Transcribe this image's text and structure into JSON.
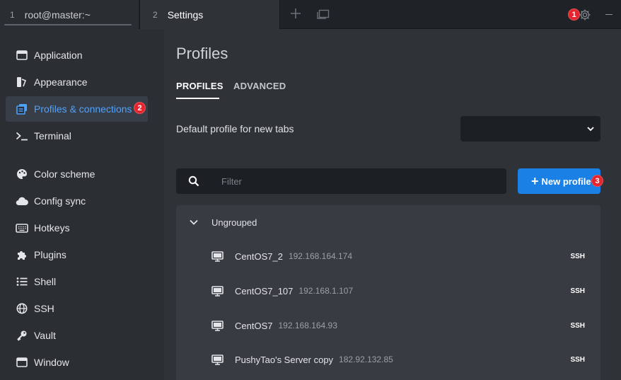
{
  "tabs": [
    {
      "num": "1",
      "title": "root@master:~"
    },
    {
      "num": "2",
      "title": "Settings"
    }
  ],
  "badges": {
    "gear": "1",
    "sidebar": "2",
    "new_profile": "3"
  },
  "sidebar": {
    "items": [
      {
        "label": "Application",
        "icon": "window-icon"
      },
      {
        "label": "Appearance",
        "icon": "palette-icon"
      },
      {
        "label": "Profiles & connections",
        "icon": "profiles-icon",
        "active": true
      },
      {
        "label": "Terminal",
        "icon": "terminal-icon"
      },
      {
        "label": "Color scheme",
        "icon": "palette-icon"
      },
      {
        "label": "Config sync",
        "icon": "cloud-icon"
      },
      {
        "label": "Hotkeys",
        "icon": "keyboard-icon"
      },
      {
        "label": "Plugins",
        "icon": "puzzle-icon"
      },
      {
        "label": "Shell",
        "icon": "list-icon"
      },
      {
        "label": "SSH",
        "icon": "globe-icon"
      },
      {
        "label": "Vault",
        "icon": "key-icon"
      },
      {
        "label": "Window",
        "icon": "window-icon"
      }
    ]
  },
  "main": {
    "title": "Profiles",
    "subtabs": [
      {
        "label": "PROFILES"
      },
      {
        "label": "ADVANCED"
      }
    ],
    "default_profile_label": "Default profile for new tabs",
    "default_profile_value": "",
    "filter_placeholder": "Filter",
    "new_profile_label": "New profile",
    "group": {
      "name": "Ungrouped"
    },
    "profiles": [
      {
        "name": "CentOS7_2",
        "host": "192.168.164.174",
        "type": "SSH"
      },
      {
        "name": "CentOS7_107",
        "host": "192.168.1.107",
        "type": "SSH"
      },
      {
        "name": "CentOS7",
        "host": "192.168.164.93",
        "type": "SSH"
      },
      {
        "name": "PushyTao's Server copy",
        "host": "182.92.132.85",
        "type": "SSH"
      }
    ]
  },
  "colors": {
    "accent": "#1a80e6",
    "active_text": "#4da3ff",
    "badge": "#e4252d"
  }
}
